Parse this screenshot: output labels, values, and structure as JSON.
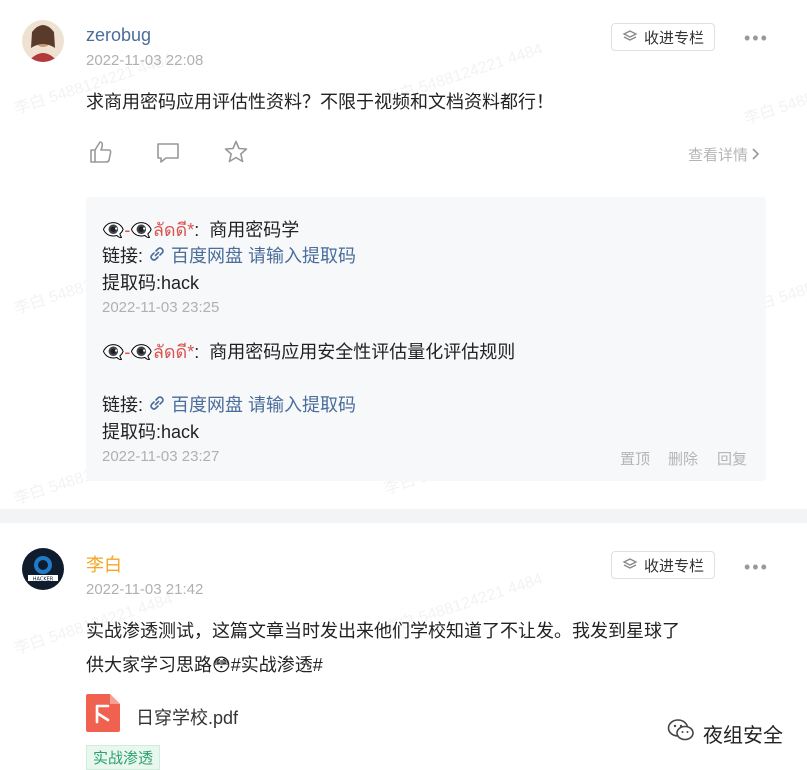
{
  "posts": [
    {
      "author": "zerobug",
      "time": "2022-11-03 22:08",
      "collect_label": "收进专栏",
      "more_label": "•••",
      "content": "求商用密码应用评估性资料？不限于视频和文档资料都行！",
      "detail_label": "查看详情",
      "comments": [
        {
          "author": "👁️‍🗨️-👁️‍🗨️ลัดดี*",
          "sep": ":",
          "text": "商用密码学",
          "link_prefix": "链接: ",
          "link_text": "百度网盘 请输入提取码",
          "code_line": "提取码:hack",
          "time": "2022-11-03 23:25"
        },
        {
          "author": "👁️‍🗨️-👁️‍🗨️ลัดดี*",
          "sep": ":",
          "text": "商用密码应用安全性评估量化评估规则",
          "link_prefix": "链接: ",
          "link_text": "百度网盘 请输入提取码",
          "code_line": "提取码:hack",
          "time": "2022-11-03 23:27",
          "ops": [
            "置顶",
            "删除",
            "回复"
          ]
        }
      ]
    },
    {
      "author": "李白",
      "time": "2022-11-03 21:42",
      "collect_label": "收进专栏",
      "more_label": "•••",
      "content_line1": "实战渗透测试，这篇文章当时发出来他们学校知道了不让发。我发到星球了",
      "content_line2": "供大家学习思路😳#实战渗透#",
      "file_name": "日穿学校.pdf",
      "tag": "实战渗透"
    }
  ],
  "brand": "夜组安全",
  "watermark": "李白 5488124221 4484",
  "colors": {
    "name_blue": "#4a6d9a",
    "name_orange": "#f5a623",
    "tag_green": "#2aa06e"
  }
}
